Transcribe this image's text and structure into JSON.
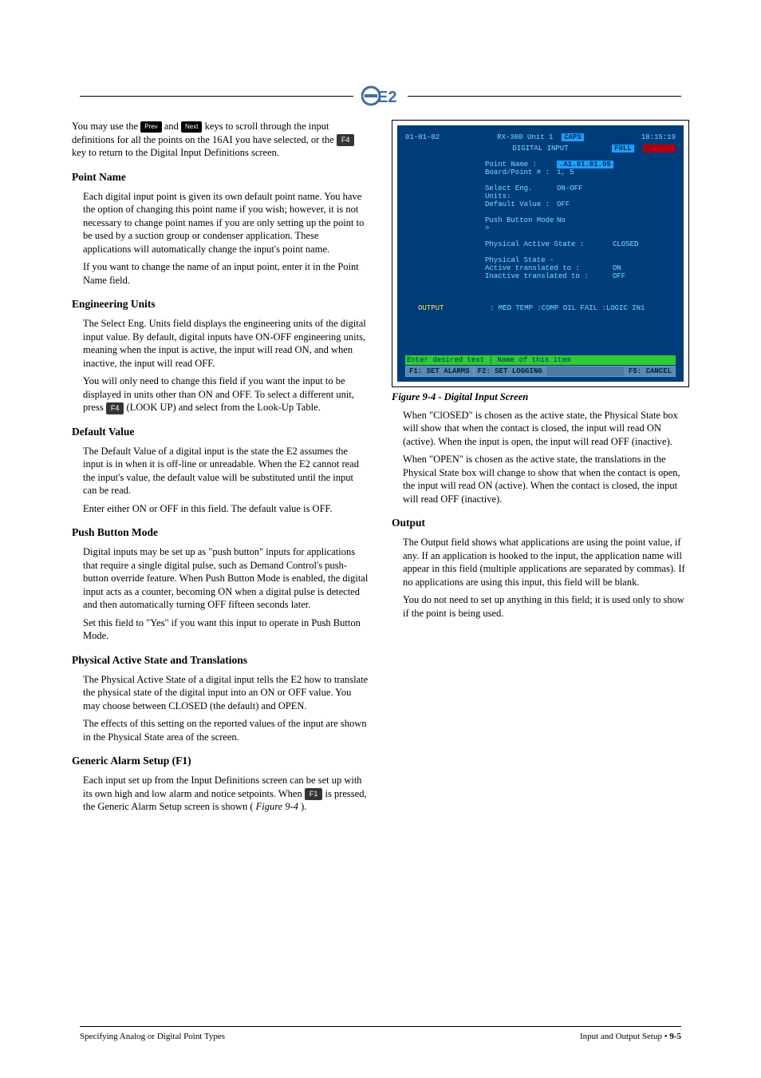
{
  "header": {
    "logo_alt": "E2 logo"
  },
  "keys": {
    "prev": "Prev",
    "next": "Next",
    "f4": "F4",
    "f1": "F1"
  },
  "left": {
    "p1_a": "You may use the ",
    "p1_b": " and ",
    "p1_c": " keys to scroll through the input definitions for all the points on the 16AI you have selected, or the ",
    "p1_d": " key to return to the Digital Input Definitions screen.",
    "h1": "Point Name",
    "p2": "Each digital input point is given its own default point name. You have the option of changing this point name if you wish; however, it is not necessary to change point names if you are only setting up the point to be used by a suction group or condenser application. These applications will automatically change the input's point name.",
    "p3": "If you want to change the name of an input point, enter it in the Point Name field.",
    "h2": "Engineering Units",
    "p4": "The Select Eng. Units field displays the engineering units of the digital input value. By default, digital inputs have ON-OFF engineering units, meaning when the input is active, the input will read ON, and when inactive, the input will read OFF.",
    "p5": "You will only need to change this field if you want the input to be displayed in units other than ON and OFF. To select a different unit, press ",
    "p5b": " (LOOK UP) and select from the Look-Up Table.",
    "h3": "Default Value",
    "p6": "The Default Value of a digital input is the state the E2 assumes the input is in when it is off-line or unreadable. When the E2 cannot read the input's value, the default value will be substituted until the input can be read.",
    "p7": "Enter either ON or OFF in this field. The default value is OFF.",
    "h4": "Push Button Mode",
    "p8": "Digital inputs may be set up as \"push button\" inputs for applications that require a single digital pulse, such as Demand Control's push-button override feature. When Push Button Mode is enabled, the digital input acts as a counter, becoming ON when a digital pulse is detected and then automatically turning OFF fifteen seconds later.",
    "p9": "Set this field to \"Yes\" if you want this input to operate in Push Button Mode.",
    "h5": "Physical Active State and Translations",
    "p10": "The Physical Active State of a digital input tells the E2 how to translate the physical state of the digital input into an ON or OFF value. You may choose between CLOSED (the default) and OPEN.",
    "p11": "The effects of this setting on the reported values of the input are shown in the Physical State area of the screen.",
    "h6": "Generic Alarm Setup (F1)",
    "p12": "Each input set up from the Input Definitions screen can be set up with its own high and low alarm and notice setpoints. When ",
    "p12b": " is pressed, the Generic Alarm Setup screen is shown (",
    "p12c": ")."
  },
  "figref": {
    "caption_num": "Figure 9-4",
    "caption_text": " - Digital Input Screen"
  },
  "term": {
    "date": "01-01-02",
    "unit": "RX-300 Unit 1",
    "caps": "CAPS",
    "time": "18:15:19",
    "title": "DIGITAL INPUT",
    "full": "FULL",
    "rows": [
      {
        "lab": "Point Name        :",
        "val": ".A1.01.01.05",
        "hl": true
      },
      {
        "lab": "Board/Point #     :",
        "val": "  1,  5"
      }
    ],
    "rows2": [
      {
        "lab": "Select Eng. Units:",
        "val": "ON-OFF"
      },
      {
        "lab": "Default Value    :",
        "val": "    OFF"
      }
    ],
    "rows3": [
      {
        "lab": "Push Button Mode >",
        "val": "  No"
      }
    ],
    "rows4": [
      {
        "lab": "Physical Active State    :",
        "val": "   CLOSED"
      }
    ],
    "phys_hdr": "Physical State -",
    "rows5": [
      {
        "lab": "  Active translated to   :",
        "val": "       ON"
      },
      {
        "lab": "  Inactive translated to :",
        "val": "      OFF"
      }
    ],
    "output_lab": "OUTPUT",
    "output_val": ": MED TEMP :COMP OIL FAIL :LOGIC IN1",
    "hint": "Enter desired text   | Name of this item",
    "fk1": "F1: SET ALARMS",
    "fk2": "F2: SET LOGGING",
    "fk5": "F5: CANCEL"
  },
  "right": {
    "p1_a": "When \"ClOSED\" is chosen as the active state, the Physical State box will show that when the contact is closed, the input will read ON (active). When the input is open, the input will read OFF (inactive).",
    "p1_b": "When \"OPEN\" is chosen as the active state, the translations in the Physical State box will change to show that when the contact is open, the input will read ON (active). When the contact is closed, the input will read OFF (inactive).",
    "h1": "Output",
    "p2": "The Output field shows what applications are using the point value, if any. If an application is hooked to the input, the application name will appear in this field (multiple applications are separated by commas). If no applications are using this input, this field will be blank.",
    "p3": "You do not need to set up anything in this field; it is used only to show if the point is being used."
  },
  "footer": {
    "left": "Specifying Analog or Digital Point Types",
    "right_a": "Input and Output Setup  • ",
    "right_b": "9-5"
  }
}
